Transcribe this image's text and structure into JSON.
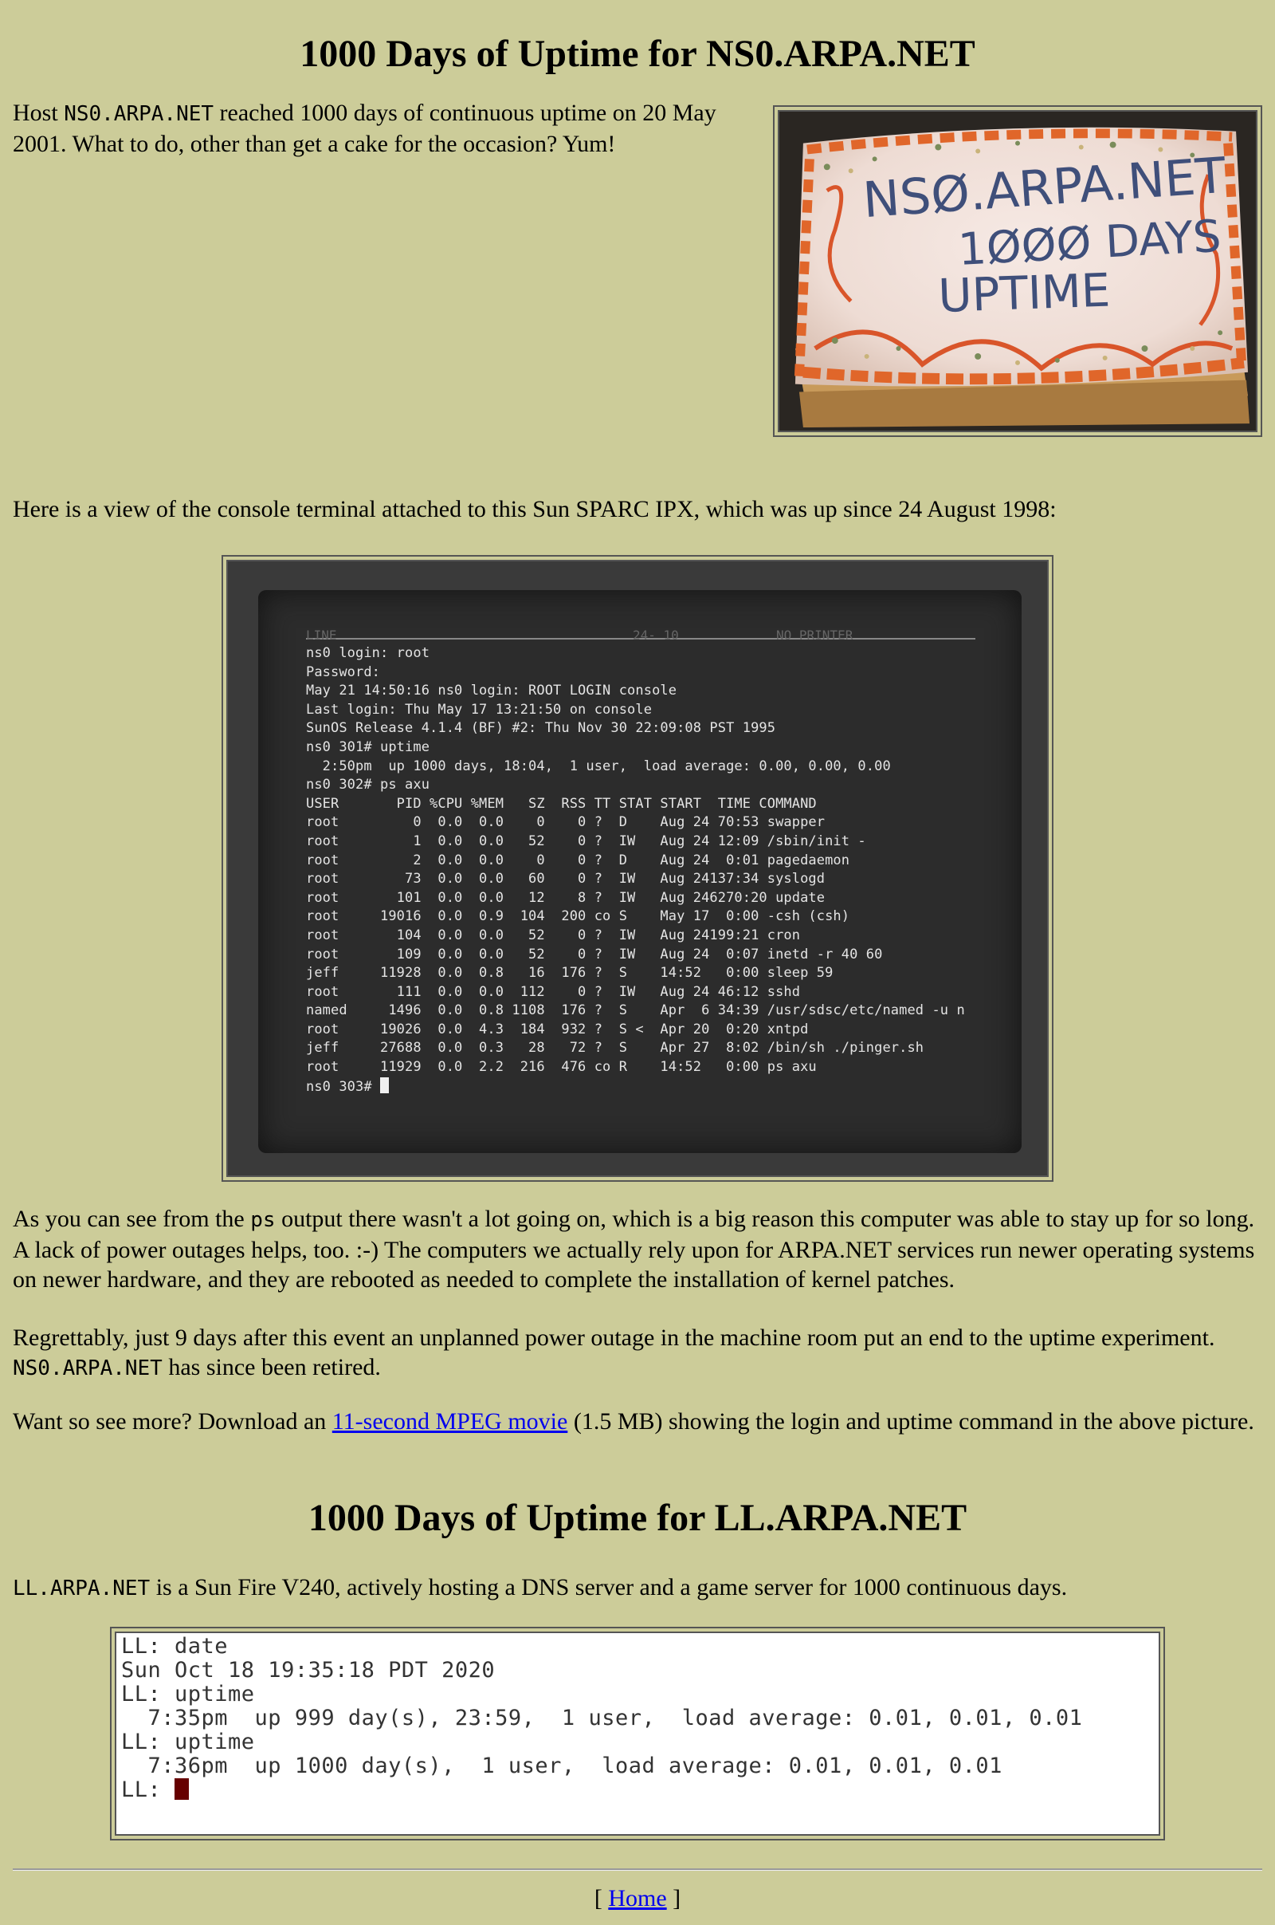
{
  "ns0": {
    "title": "1000 Days of Uptime for NS0.ARPA.NET",
    "intro": {
      "prefix": "Host ",
      "host": "NS0.ARPA.NET",
      "suffix": " reached 1000 days of continuous uptime on 20 May 2001. What to do, other than get a cake for the occasion? Yum!"
    },
    "cake_image": {
      "alt": "Cake reading NS0.ARPA.NET 1000 DAYS UPTIME",
      "line1": "NSØ.ARPA.NET",
      "line2": "1ØØØ DAYS",
      "line3": "UPTIME"
    },
    "console_intro": "Here is a view of the console terminal attached to this Sun SPARC IPX, which was up since 24 August 1998:",
    "console_header": {
      "left": "LINE",
      "middle": "24- 10",
      "right": "NO PRINTER"
    },
    "console_lines": [
      "ns0 login: root",
      "Password:",
      "May 21 14:50:16 ns0 login: ROOT LOGIN console",
      "Last login: Thu May 17 13:21:50 on console",
      "SunOS Release 4.1.4 (BF) #2: Thu Nov 30 22:09:08 PST 1995",
      "ns0 301# uptime",
      "  2:50pm  up 1000 days, 18:04,  1 user,  load average: 0.00, 0.00, 0.00",
      "ns0 302# ps axu",
      "USER       PID %CPU %MEM   SZ  RSS TT STAT START  TIME COMMAND",
      "root         0  0.0  0.0    0    0 ?  D    Aug 24 70:53 swapper",
      "root         1  0.0  0.0   52    0 ?  IW   Aug 24 12:09 /sbin/init -",
      "root         2  0.0  0.0    0    0 ?  D    Aug 24  0:01 pagedaemon",
      "root        73  0.0  0.0   60    0 ?  IW   Aug 24137:34 syslogd",
      "root       101  0.0  0.0   12    8 ?  IW   Aug 246270:20 update",
      "root     19016  0.0  0.9  104  200 co S    May 17  0:00 -csh (csh)",
      "root       104  0.0  0.0   52    0 ?  IW   Aug 24199:21 cron",
      "root       109  0.0  0.0   52    0 ?  IW   Aug 24  0:07 inetd -r 40 60",
      "jeff     11928  0.0  0.8   16  176 ?  S    14:52   0:00 sleep 59",
      "root       111  0.0  0.0  112    0 ?  IW   Aug 24 46:12 sshd",
      "named     1496  0.0  0.8 1108  176 ?  S    Apr  6 34:39 /usr/sdsc/etc/named -u n",
      "root     19026  0.0  4.3  184  932 ?  S <  Apr 20  0:20 xntpd",
      "jeff     27688  0.0  0.3   28   72 ?  S    Apr 27  8:02 /bin/sh ./pinger.sh",
      "root     11929  0.0  2.2  216  476 co R    14:52   0:00 ps axu"
    ],
    "console_prompt": "ns0 303# ",
    "ps_para": {
      "prefix": "As you can see from the ",
      "cmd": "ps",
      "suffix": " output there wasn't a lot going on, which is a big reason this computer was able to stay up for so long. A lack of power outages helps, too. :-) The computers we actually rely upon for ARPA.NET services run newer operating systems on newer hardware, and they are rebooted as needed to complete the installation of kernel patches."
    },
    "outage_para": {
      "prefix": "Regrettably, just 9 days after this event an unplanned power outage in the machine room put an end to the uptime experiment. ",
      "host": "NS0.ARPA.NET",
      "suffix": " has since been retired."
    },
    "movie_para": {
      "prefix": "Want so see more? Download an ",
      "link": "11-second MPEG movie",
      "suffix": " (1.5 MB) showing the login and uptime command in the above picture."
    }
  },
  "ll": {
    "title": "1000 Days of Uptime for LL.ARPA.NET",
    "intro": {
      "host": "LL.ARPA.NET",
      "suffix": " is a Sun Fire V240, actively hosting a DNS server and a game server for 1000 continuous days."
    },
    "terminal_lines": [
      "LL: date",
      "Sun Oct 18 19:35:18 PDT 2020",
      "LL: uptime",
      "  7:35pm  up 999 day(s), 23:59,  1 user,  load average: 0.01, 0.01, 0.01",
      "LL: uptime",
      "  7:36pm  up 1000 day(s),  1 user,  load average: 0.01, 0.01, 0.01"
    ],
    "terminal_prompt": "LL: "
  },
  "footer": {
    "open": "[ ",
    "home": "Home",
    "close": " ]"
  }
}
